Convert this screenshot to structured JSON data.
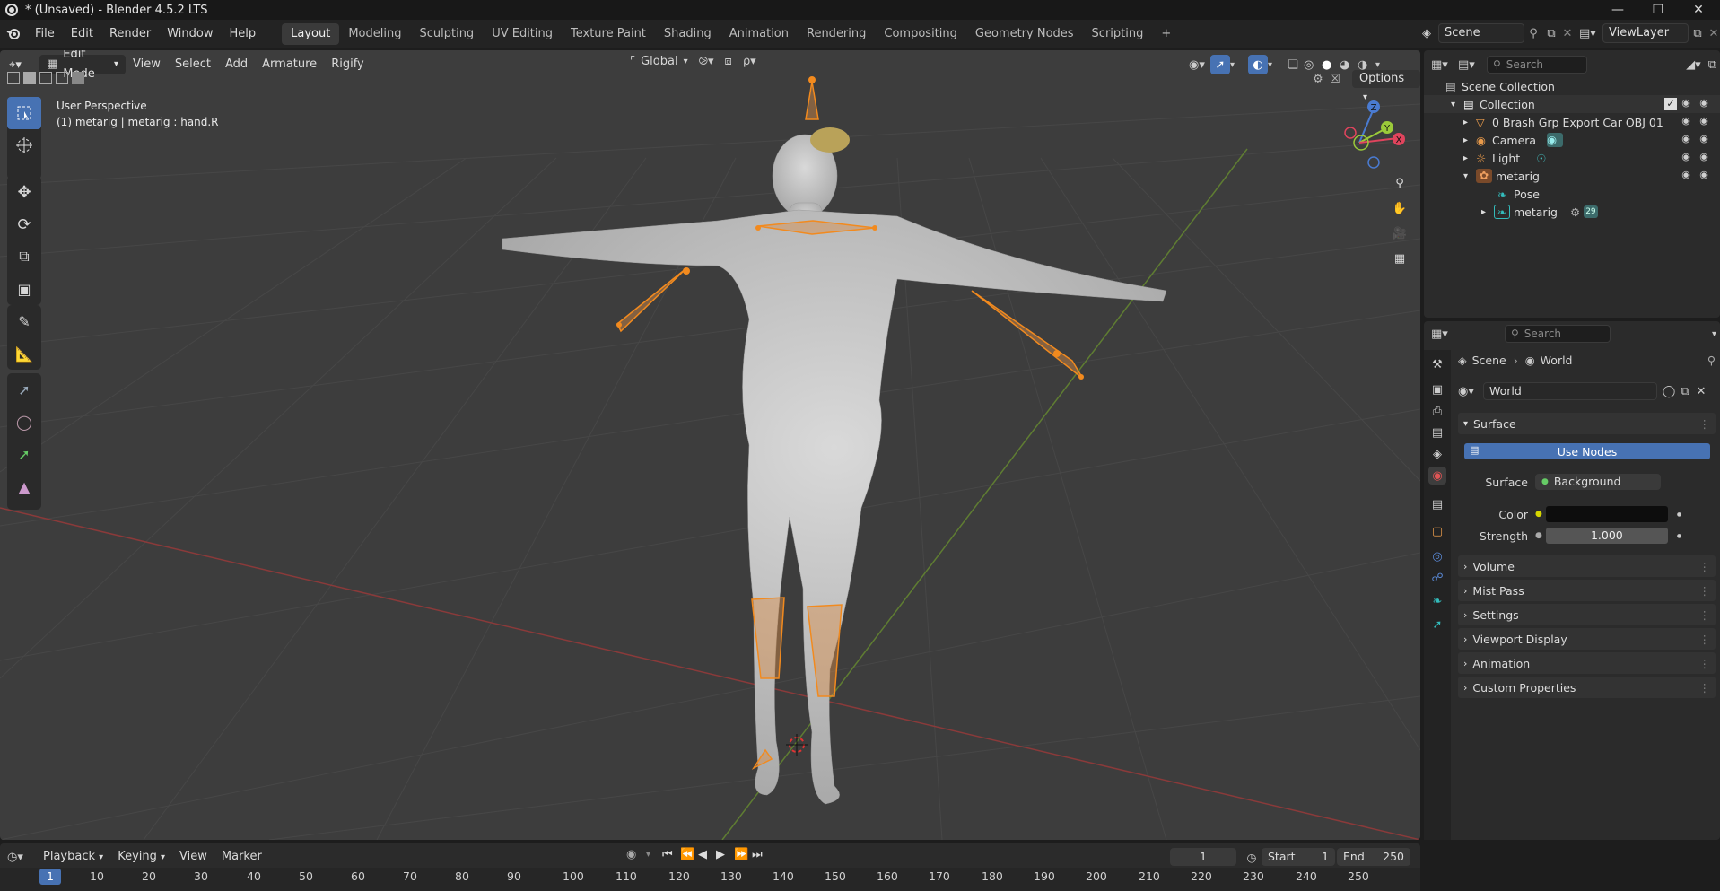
{
  "window": {
    "title": "* (Unsaved) - Blender 4.5.2 LTS"
  },
  "menus": [
    "File",
    "Edit",
    "Render",
    "Window",
    "Help"
  ],
  "workspaces": [
    "Layout",
    "Modeling",
    "Sculpting",
    "UV Editing",
    "Texture Paint",
    "Shading",
    "Animation",
    "Rendering",
    "Compositing",
    "Geometry Nodes",
    "Scripting"
  ],
  "active_workspace": "Layout",
  "scene": {
    "name": "Scene",
    "view_layer": "ViewLayer"
  },
  "viewport": {
    "mode": "Edit Mode",
    "header_menus": [
      "View",
      "Select",
      "Add",
      "Armature",
      "Rigify"
    ],
    "transform_orientation": "Global",
    "options_label": "Options",
    "overlay_line1": "User Perspective",
    "overlay_line2": "(1) metarig | metarig : hand.R",
    "gizmo": {
      "x": "X",
      "y": "Y",
      "z": "Z"
    }
  },
  "outliner": {
    "search_placeholder": "Search",
    "scene_collection": "Scene Collection",
    "rows": [
      {
        "label": "Collection"
      },
      {
        "label": "0 Brash Grp Export Car OBJ 01"
      },
      {
        "label": "Camera"
      },
      {
        "label": "Light"
      },
      {
        "label": "metarig"
      },
      {
        "label": "Pose"
      },
      {
        "label": "metarig",
        "badge": "29"
      }
    ]
  },
  "properties": {
    "search_placeholder": "Search",
    "breadcrumb": [
      "Scene",
      "World"
    ],
    "world_name": "World",
    "surface_panel": "Surface",
    "use_nodes": "Use Nodes",
    "surface_label": "Surface",
    "surface_value": "Background",
    "color_label": "Color",
    "strength_label": "Strength",
    "strength_value": "1.000",
    "panels": [
      "Volume",
      "Mist Pass",
      "Settings",
      "Viewport Display",
      "Animation",
      "Custom Properties"
    ],
    "colors": {
      "accent": "#4772b3",
      "world_color": "#0d0d0d"
    }
  },
  "timeline": {
    "menus": [
      "Playback",
      "Keying",
      "View",
      "Marker"
    ],
    "current_frame": "1",
    "start_label": "Start",
    "start_value": "1",
    "end_label": "End",
    "end_value": "250",
    "ticks": [
      "1",
      "10",
      "20",
      "30",
      "40",
      "50",
      "60",
      "70",
      "80",
      "90",
      "100",
      "110",
      "120",
      "130",
      "140",
      "150",
      "160",
      "170",
      "180",
      "190",
      "200",
      "210",
      "220",
      "230",
      "240",
      "250"
    ]
  }
}
